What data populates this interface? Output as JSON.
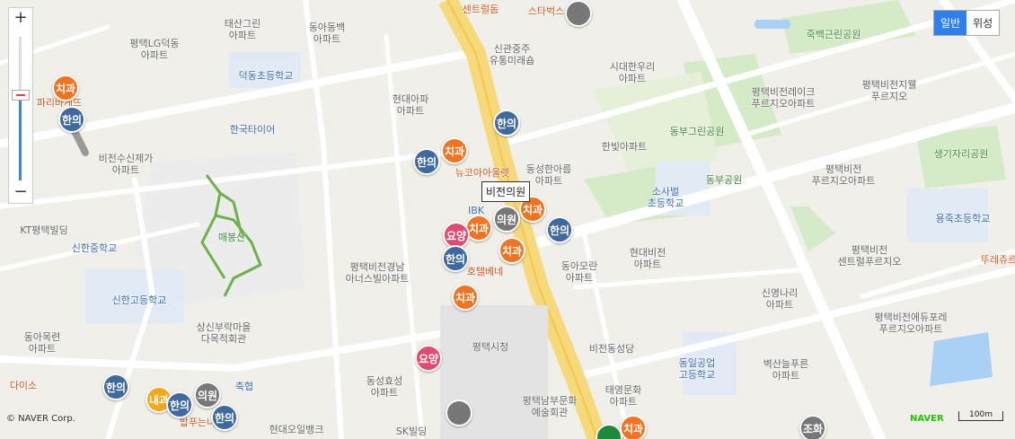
{
  "map": {
    "copyright": "© NAVER Corp.",
    "provider": "NAVER",
    "scale_label": "100m",
    "map_type": {
      "general": "일반",
      "satellite": "위성"
    },
    "zoom": {
      "plus": "+",
      "minus": "−",
      "level": 0.6
    },
    "tooltip": "비전의원",
    "labels": [
      {
        "text": "센트럴돔",
        "cls": "red"
      },
      {
        "text": "스타벅스",
        "cls": "red"
      },
      {
        "text": "태산그린\n아파트",
        "cls": "dark"
      },
      {
        "text": "평택LG덕동\n아파트",
        "cls": "dark"
      },
      {
        "text": "동아동백\n아파트",
        "cls": "dark"
      },
      {
        "text": "신관중주\n유통미래숍",
        "cls": "dark"
      },
      {
        "text": "시대한우리\n아파트",
        "cls": "dark"
      },
      {
        "text": "죽백근린공원",
        "cls": "green"
      },
      {
        "text": "파리바게뜨",
        "cls": "red"
      },
      {
        "text": "덕동초등학교",
        "cls": "blue"
      },
      {
        "text": "현대아파\n아파트",
        "cls": "dark"
      },
      {
        "text": "평택비전레이크\n푸르지오아파트",
        "cls": "dark"
      },
      {
        "text": "평택비전지웰\n푸르지오",
        "cls": "dark"
      },
      {
        "text": "한국타이어",
        "cls": "blue"
      },
      {
        "text": "동부그린공원",
        "cls": "green"
      },
      {
        "text": "한빛아파트",
        "cls": "dark"
      },
      {
        "text": "비전수신제가\n아파트",
        "cls": "dark"
      },
      {
        "text": "뉴코아아울렛",
        "cls": "red"
      },
      {
        "text": "동성한아름\n아파트",
        "cls": "dark"
      },
      {
        "text": "생기자리공원",
        "cls": "green"
      },
      {
        "text": "평택비전\n푸르지오아파트",
        "cls": "dark"
      },
      {
        "text": "동부공원",
        "cls": "green"
      },
      {
        "text": "소사벌\n초등학교",
        "cls": "blue"
      },
      {
        "text": "KT평택빌딩",
        "cls": "dark"
      },
      {
        "text": "IBK",
        "cls": "blue"
      },
      {
        "text": "용죽초등학교",
        "cls": "blue"
      },
      {
        "text": "매봉산",
        "cls": "green"
      },
      {
        "text": "신한중학교",
        "cls": "blue"
      },
      {
        "text": "현대비전\n아파트",
        "cls": "dark"
      },
      {
        "text": "평택비전\n센트럴푸르지오",
        "cls": "dark"
      },
      {
        "text": "뚜레쥬르",
        "cls": "red"
      },
      {
        "text": "평택비전경남\n아너스빌아파트",
        "cls": "dark"
      },
      {
        "text": "호텔베네",
        "cls": "red"
      },
      {
        "text": "동아모란\n아파트",
        "cls": "dark"
      },
      {
        "text": "신한고등학교",
        "cls": "blue"
      },
      {
        "text": "신명나리\n아파트",
        "cls": "dark"
      },
      {
        "text": "동아목련\n아파트",
        "cls": "dark"
      },
      {
        "text": "상신부락마을\n다목적회관",
        "cls": "dark"
      },
      {
        "text": "평택비전에듀포레\n푸르지오아파트",
        "cls": "dark"
      },
      {
        "text": "평택시청",
        "cls": "dark"
      },
      {
        "text": "비전동성당",
        "cls": "dark"
      },
      {
        "text": "동일공업\n고등학교",
        "cls": "blue"
      },
      {
        "text": "벽산늘푸른\n아파트",
        "cls": "dark"
      },
      {
        "text": "다이소",
        "cls": "red"
      },
      {
        "text": "축협",
        "cls": "blue"
      },
      {
        "text": "동성효성\n아파트",
        "cls": "dark"
      },
      {
        "text": "평택남부문화\n예술회관",
        "cls": "dark"
      },
      {
        "text": "태영문화\n아파트",
        "cls": "dark"
      },
      {
        "text": "현대오일뱅크",
        "cls": "dark"
      },
      {
        "text": "SK빌딩",
        "cls": "dark"
      },
      {
        "text": "밥푸는나",
        "cls": "red"
      }
    ],
    "markers": [
      {
        "label": "치과",
        "color": "orange"
      },
      {
        "label": "한의",
        "color": "blue"
      },
      {
        "label": "한의",
        "color": "blue"
      },
      {
        "label": "치과",
        "color": "orange"
      },
      {
        "label": "한의",
        "color": "blue"
      },
      {
        "label": "치과",
        "color": "orange"
      },
      {
        "label": "치과",
        "color": "orange"
      },
      {
        "label": "의원",
        "color": "gray"
      },
      {
        "label": "치과",
        "color": "orange"
      },
      {
        "label": "한의",
        "color": "blue"
      },
      {
        "label": "요양",
        "color": "pink"
      },
      {
        "label": "치과",
        "color": "orange"
      },
      {
        "label": "한의",
        "color": "blue"
      },
      {
        "label": "요양",
        "color": "pink"
      },
      {
        "label": "한의",
        "color": "blue"
      },
      {
        "label": "내과",
        "color": "yellow"
      },
      {
        "label": "한의",
        "color": "blue"
      },
      {
        "label": "의원",
        "color": "gray"
      },
      {
        "label": "한의",
        "color": "blue"
      },
      {
        "label": "치과",
        "color": "orange"
      },
      {
        "label": "",
        "color": "gray"
      },
      {
        "label": "",
        "color": "gray"
      },
      {
        "label": "조화",
        "color": "gray"
      },
      {
        "label": "",
        "color": "green"
      }
    ]
  }
}
